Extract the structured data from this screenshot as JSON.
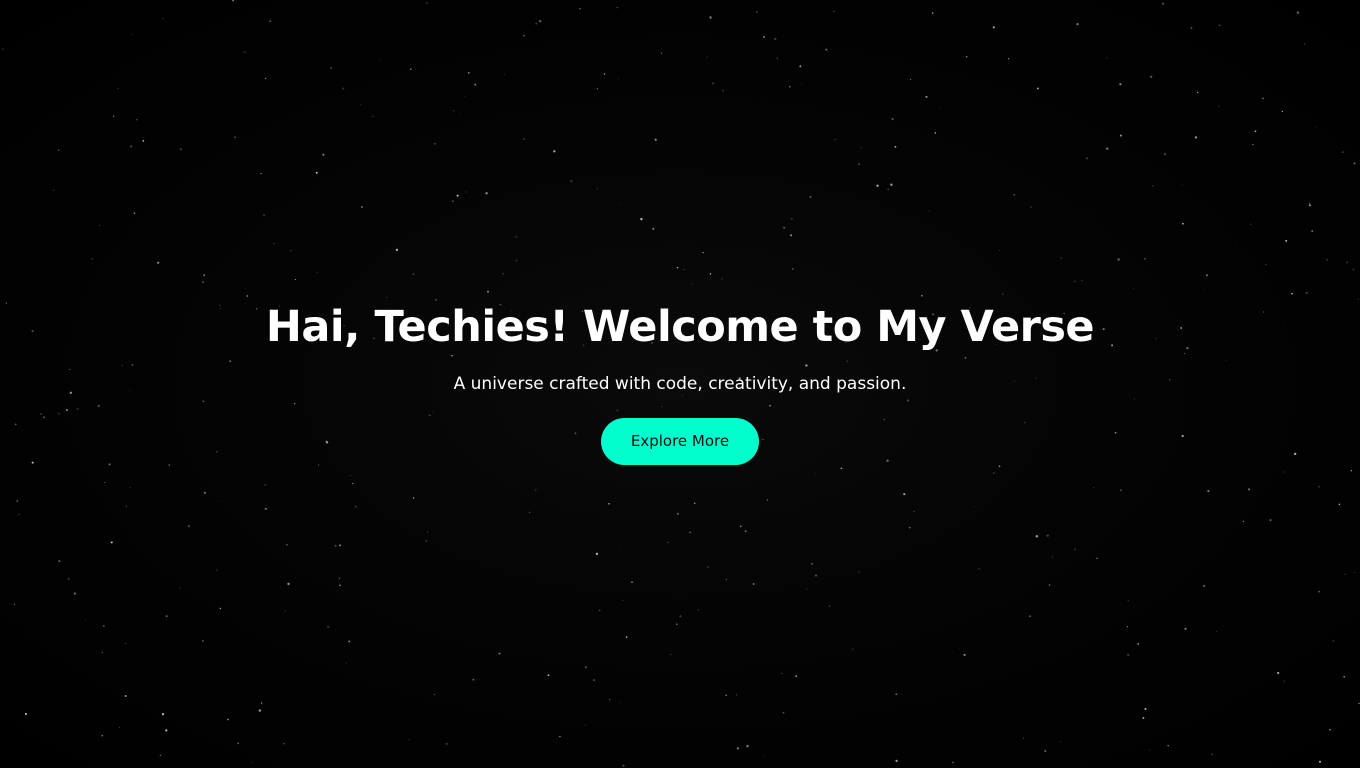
{
  "hero": {
    "title": "Hai, Techies! Welcome to My Verse",
    "subtitle": "A universe crafted with code, creativity, and passion.",
    "cta_label": "Explore More"
  },
  "colors": {
    "background": "#000000",
    "accent": "#00ffcc",
    "text": "#ffffff",
    "star": "#ffffff"
  }
}
